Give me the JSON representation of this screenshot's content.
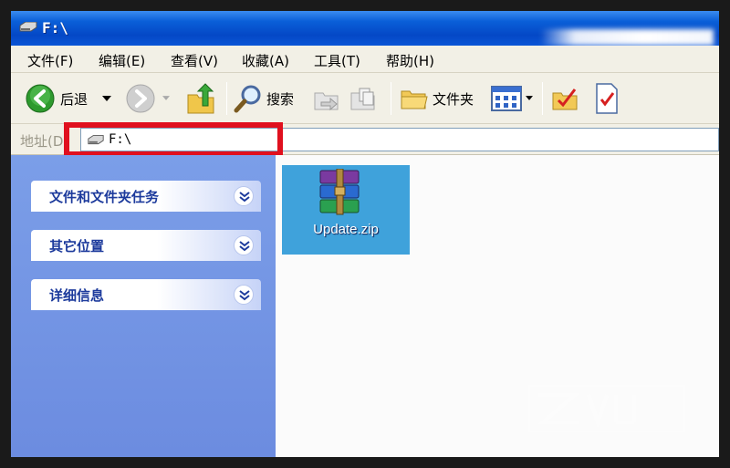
{
  "window": {
    "title": "F:\\"
  },
  "menu": {
    "items": [
      "文件(F)",
      "编辑(E)",
      "查看(V)",
      "收藏(A)",
      "工具(T)",
      "帮助(H)"
    ]
  },
  "toolbar": {
    "back_label": "后退",
    "search_label": "搜索",
    "folders_label": "文件夹"
  },
  "address": {
    "label": "地址(D)",
    "value": "F:\\"
  },
  "tasks": {
    "panels": [
      "文件和文件夹任务",
      "其它位置",
      "详细信息"
    ]
  },
  "files": [
    {
      "name": "Update.zip",
      "selected": true,
      "icon": "winrar-archive-icon"
    }
  ],
  "colors": {
    "titlebar": "#0448c6",
    "selection": "#3fa2db",
    "highlight": "#e0101e",
    "leftpane": "#7b9ee8"
  }
}
